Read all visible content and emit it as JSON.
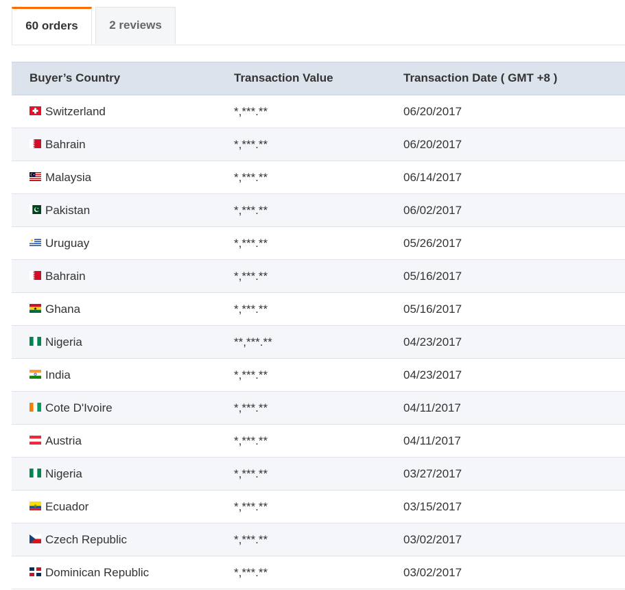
{
  "tabs": [
    {
      "label": "60 orders",
      "active": true
    },
    {
      "label": "2 reviews",
      "active": false
    }
  ],
  "table": {
    "headers": {
      "country": "Buyer’s Country",
      "value": "Transaction Value",
      "date": "Transaction Date ( GMT +8 )"
    },
    "rows": [
      {
        "flag": "switzerland-flag-icon",
        "country": "Switzerland",
        "value": "*,***.**",
        "date": "06/20/2017"
      },
      {
        "flag": "bahrain-flag-icon",
        "country": "Bahrain",
        "value": "*,***.**",
        "date": "06/20/2017"
      },
      {
        "flag": "malaysia-flag-icon",
        "country": "Malaysia",
        "value": "*,***.**",
        "date": "06/14/2017"
      },
      {
        "flag": "pakistan-flag-icon",
        "country": "Pakistan",
        "value": "*,***.**",
        "date": "06/02/2017"
      },
      {
        "flag": "uruguay-flag-icon",
        "country": "Uruguay",
        "value": "*,***.**",
        "date": "05/26/2017"
      },
      {
        "flag": "bahrain-flag-icon",
        "country": "Bahrain",
        "value": "*,***.**",
        "date": "05/16/2017"
      },
      {
        "flag": "ghana-flag-icon",
        "country": "Ghana",
        "value": "*,***.**",
        "date": "05/16/2017"
      },
      {
        "flag": "nigeria-flag-icon",
        "country": "Nigeria",
        "value": "**,***.**",
        "date": "04/23/2017"
      },
      {
        "flag": "india-flag-icon",
        "country": "India",
        "value": "*,***.**",
        "date": "04/23/2017"
      },
      {
        "flag": "cote-divoire-flag-icon",
        "country": "Cote D'Ivoire",
        "value": "*,***.**",
        "date": "04/11/2017"
      },
      {
        "flag": "austria-flag-icon",
        "country": "Austria",
        "value": "*,***.**",
        "date": "04/11/2017"
      },
      {
        "flag": "nigeria-flag-icon",
        "country": "Nigeria",
        "value": "*,***.**",
        "date": "03/27/2017"
      },
      {
        "flag": "ecuador-flag-icon",
        "country": "Ecuador",
        "value": "*,***.**",
        "date": "03/15/2017"
      },
      {
        "flag": "czech-republic-flag-icon",
        "country": "Czech Republic",
        "value": "*,***.**",
        "date": "03/02/2017"
      },
      {
        "flag": "dominican-republic-flag-icon",
        "country": "Dominican Republic",
        "value": "*,***.**",
        "date": "03/02/2017"
      }
    ]
  },
  "colors": {
    "accent": "#ff6a00",
    "header_bg": "#dde3ec",
    "row_alt_bg": "#f4f6f9"
  }
}
